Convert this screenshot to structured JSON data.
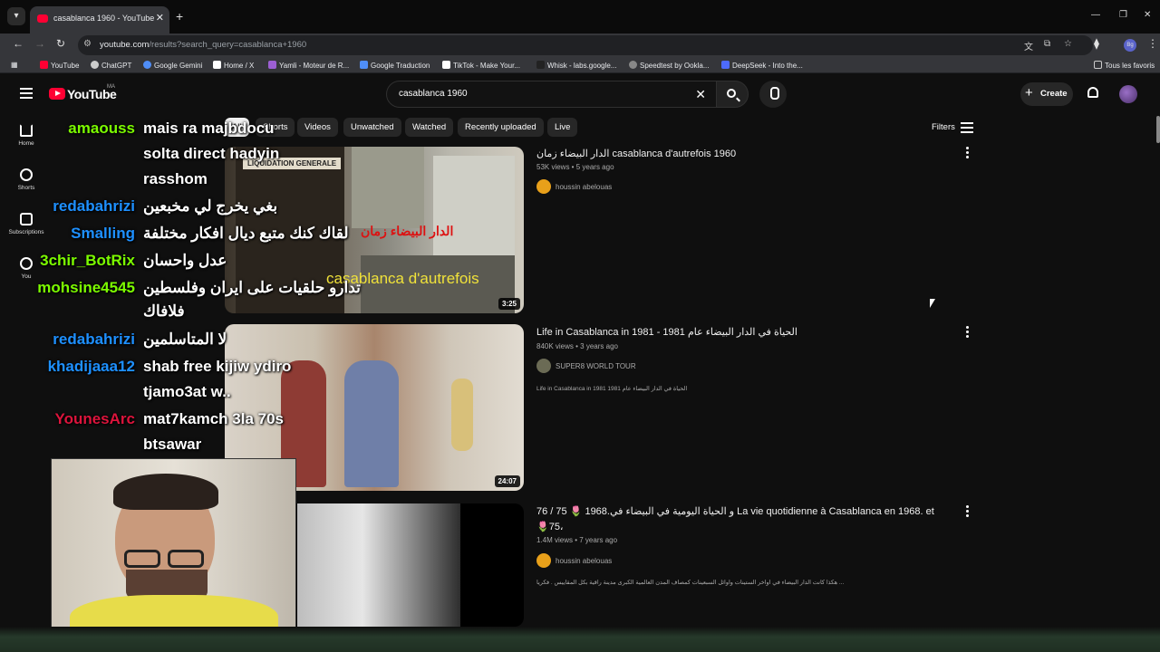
{
  "browser": {
    "tab_title": "casablanca 1960 - YouTube",
    "url_domain": "youtube.com",
    "url_path": "/results?search_query=casablanca+1960",
    "bookmarks": [
      {
        "label": "YouTube",
        "color": "#ff0033"
      },
      {
        "label": "ChatGPT",
        "color": "#cccccc"
      },
      {
        "label": "Google Gemini",
        "color": "#4f8ef7"
      },
      {
        "label": "Home / X",
        "color": "#ffffff"
      },
      {
        "label": "Yamli - Moteur de R...",
        "color": "#9c5fd3"
      },
      {
        "label": "Google Traduction",
        "color": "#4f8ef7"
      },
      {
        "label": "TikTok - Make Your...",
        "color": "#ffffff"
      },
      {
        "label": "Whisk - labs.google...",
        "color": "#222222"
      },
      {
        "label": "Speedtest by Ookla...",
        "color": "#888888"
      },
      {
        "label": "DeepSeek - Into the...",
        "color": "#4d6bfe"
      }
    ],
    "all_bookmarks": "Tous les favoris"
  },
  "youtube": {
    "logo_text": "YouTube",
    "country_code": "MA",
    "search_query": "casablanca 1960",
    "create_label": "Create",
    "sidebar": [
      {
        "label": "Home"
      },
      {
        "label": "Shorts"
      },
      {
        "label": "Subscriptions"
      },
      {
        "label": "You"
      }
    ],
    "chips": [
      "All",
      "Shorts",
      "Videos",
      "Unwatched",
      "Watched",
      "Recently uploaded",
      "Live"
    ],
    "filters_label": "Filters",
    "results": [
      {
        "title": "الدار البيضاء زمان casablanca d'autrefois 1960",
        "meta": "53K views • 5 years ago",
        "channel": "houssin abelouas",
        "duration": "3:25",
        "thumb_text_ar": "الدار البيضاء زمان",
        "thumb_text_fr": "casablanca d'autrefois",
        "thumb_sign": "LIQUIDATION GENERALE",
        "description": ""
      },
      {
        "title": "Life in Casablanca in 1981 - 1981 الحياة في الدار البيضاء عام",
        "meta": "840K views • 3 years ago",
        "channel": "SUPER8 WORLD TOUR",
        "duration": "24:07",
        "description": "Life in Casablanca in 1981 1981 الحياة في الدار البيضاء عام"
      },
      {
        "title": "76 / 75 🌷 1968.و الحياة اليومية في البيضاء في La vie quotidienne à Casablanca en 1968. et",
        "title_line2": "🌷75،",
        "meta": "1.4M views • 7 years ago",
        "channel": "houssin abelouas",
        "description": "هكذا كانت الدار البيضاء في اواخر الستينات واوائل السبعينات كمصاف المدن العالمية الكبرى مدينة راقية بكل المقاييس . فكريا ..."
      }
    ]
  },
  "chat": [
    {
      "name": "amaouss",
      "name_color": "#7cfc00",
      "message": "mais ra majbdocu"
    },
    {
      "name": "",
      "name_color": "#ffffff",
      "message": "solta direct hadyin"
    },
    {
      "name": "",
      "name_color": "#ffffff",
      "message": "rasshom"
    },
    {
      "name": "redabahrizi",
      "name_color": "#1e90ff",
      "message": "بغي يخرج لي مخبعين"
    },
    {
      "name": "Smalling",
      "name_color": "#1e90ff",
      "message": "لقاك كنك متبع ديال افكار مختلفة"
    },
    {
      "name": "3chir_BotRix",
      "name_color": "#7cfc00",
      "message": "عدل واحسان"
    },
    {
      "name": "mohsine4545",
      "name_color": "#7cfc00",
      "message": "تدارو حلقيات على ايران وفلسطين"
    },
    {
      "name": "",
      "name_color": "#ffffff",
      "message": "فلافاك"
    },
    {
      "name": "redabahrizi",
      "name_color": "#1e90ff",
      "message": "لا المتاسلمين"
    },
    {
      "name": "khadijaaa12",
      "name_color": "#1e90ff",
      "message": "shab free kijiw ydiro"
    },
    {
      "name": "",
      "name_color": "#ffffff",
      "message": "tjamo3at w.."
    },
    {
      "name": "YounesArc",
      "name_color": "#dc143c",
      "message": "mat7kamch 3la 70s"
    },
    {
      "name": "",
      "name_color": "#ffffff",
      "message": "btsawar"
    }
  ],
  "icons": [
    "menu-icon",
    "youtube-logo-icon",
    "search-icon",
    "mic-icon",
    "bell-icon",
    "filters-icon",
    "more-vert-icon"
  ]
}
